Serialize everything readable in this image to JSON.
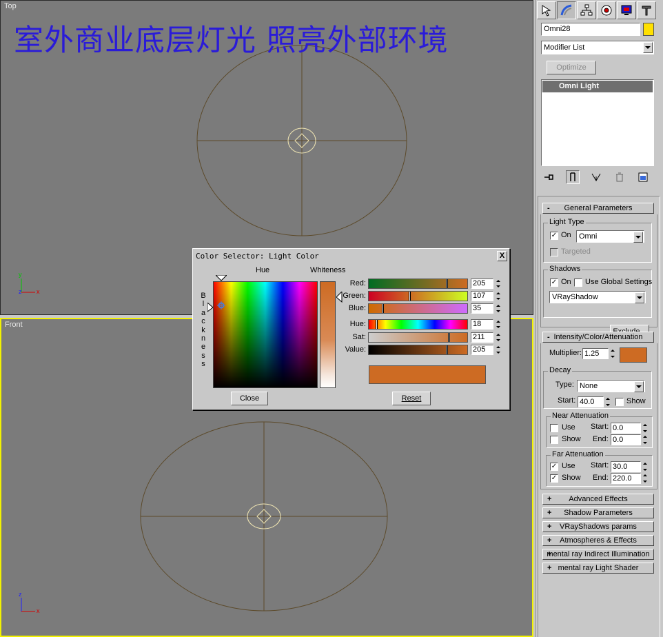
{
  "overlay_title": "室外商业底层灯光 照亮外部环境",
  "viewports": {
    "top": {
      "label": "Top"
    },
    "front": {
      "label": "Front"
    }
  },
  "axis": {
    "y": "y",
    "z": "z",
    "x": "x"
  },
  "command_panel": {
    "tabs": [
      "create-icon",
      "modify-icon",
      "hierarchy-icon",
      "motion-icon",
      "display-icon",
      "utilities-icon"
    ],
    "object_name": "Omni28",
    "object_color": "#ffe000",
    "modifier_list": "Modifier List",
    "optimize_label": "Optimize",
    "stack_item": "Omni Light"
  },
  "general_parameters": {
    "header": "General Parameters",
    "sign": "-",
    "light_type_group": "Light Type",
    "on_label": "On",
    "on_checked": true,
    "light_type_value": "Omni",
    "targeted_label": "Targeted",
    "shadows_group": "Shadows",
    "shadows_on_label": "On",
    "shadows_on_checked": true,
    "use_global_label": "Use Global Settings",
    "shadow_type_value": "VRayShadow",
    "exclude_label": "Exclude..."
  },
  "intensity": {
    "header": "Intensity/Color/Attenuation",
    "sign": "-",
    "multiplier_label": "Multiplier:",
    "multiplier_value": "1.25",
    "light_color": "#cd6b23",
    "decay_group": "Decay",
    "type_label": "Type:",
    "type_value": "None",
    "start_label": "Start:",
    "start_value": "40.0",
    "show_label": "Show",
    "near_group": "Near Attenuation",
    "near_use_label": "Use",
    "near_show_label": "Show",
    "near_start_label": "Start:",
    "near_start_value": "0.0",
    "near_end_label": "End:",
    "near_end_value": "0.0",
    "far_group": "Far Attenuation",
    "far_use_label": "Use",
    "far_show_label": "Show",
    "far_start_label": "Start:",
    "far_start_value": "30.0",
    "far_end_label": "End:",
    "far_end_value": "220.0"
  },
  "collapsed_rollouts": [
    {
      "sign": "+",
      "label": "Advanced Effects"
    },
    {
      "sign": "+",
      "label": "Shadow Parameters"
    },
    {
      "sign": "+",
      "label": "VRayShadows params"
    },
    {
      "sign": "+",
      "label": "Atmospheres & Effects"
    },
    {
      "sign": "+",
      "label": "mental ray Indirect Illumination"
    },
    {
      "sign": "+",
      "label": "mental ray Light Shader"
    }
  ],
  "color_dialog": {
    "title": "Color Selector: Light Color",
    "close_x": "X",
    "hue_label": "Hue",
    "whiteness_label": "Whiteness",
    "blackness_label": "Blackness",
    "rows": [
      {
        "label": "Red:",
        "value": "205",
        "fraction": 0.804
      },
      {
        "label": "Green:",
        "value": "107",
        "fraction": 0.42
      },
      {
        "label": "Blue:",
        "value": "35",
        "fraction": 0.137
      },
      {
        "label": "Hue:",
        "value": "18",
        "fraction": 0.071
      },
      {
        "label": "Sat:",
        "value": "211",
        "fraction": 0.827
      },
      {
        "label": "Value:",
        "value": "205",
        "fraction": 0.804
      }
    ],
    "swatch_color": "#cd6b23",
    "close_button": "Close",
    "reset_button": "Reset"
  }
}
